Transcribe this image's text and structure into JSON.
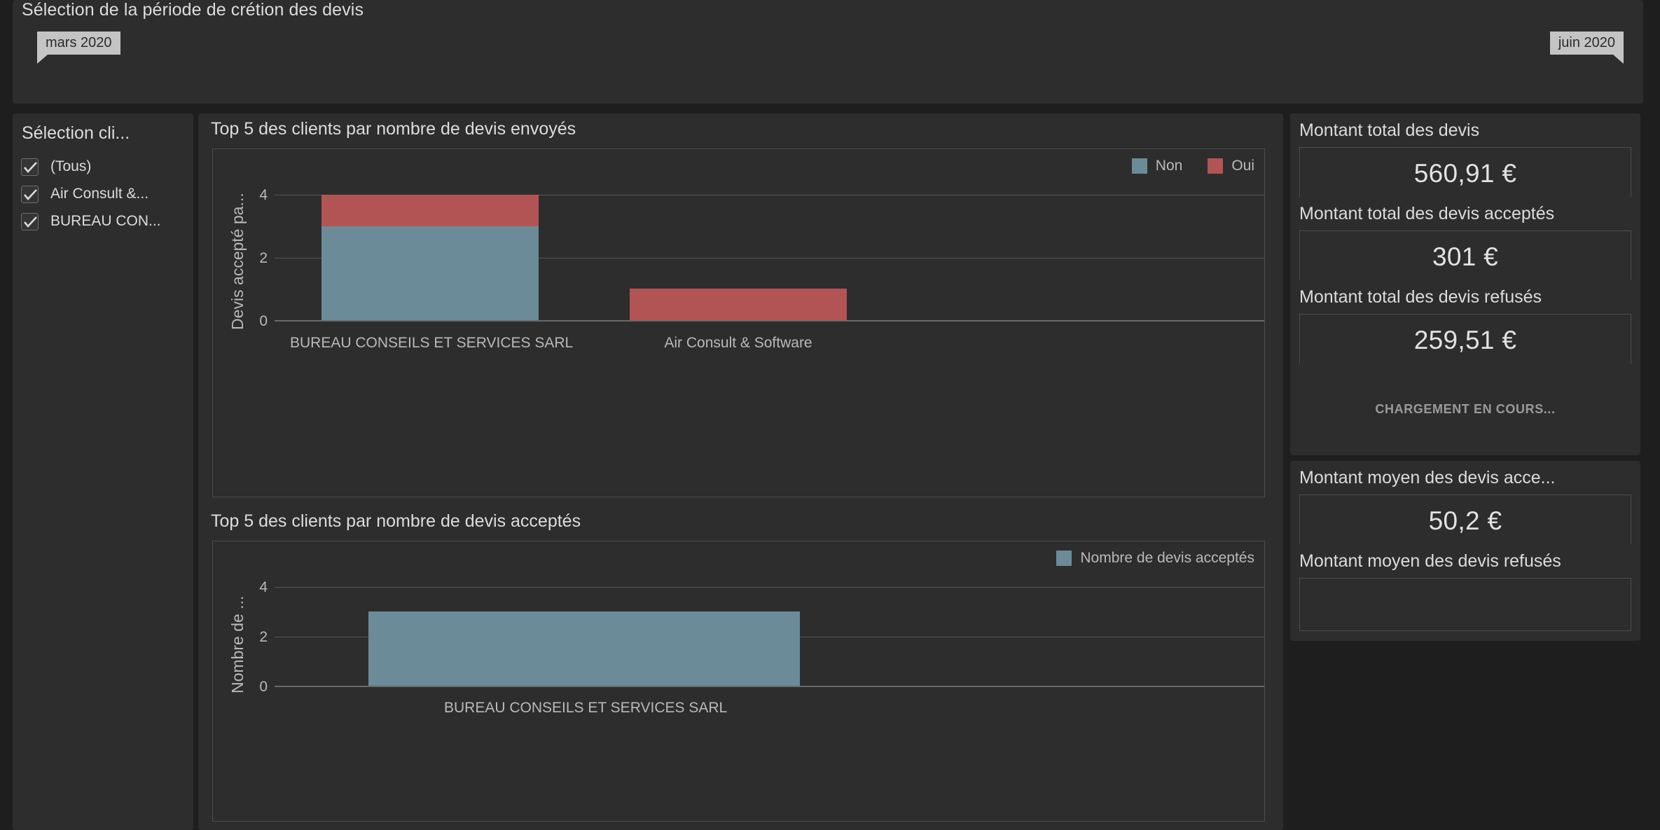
{
  "period": {
    "title": "Sélection de la période de crétion des devis",
    "start_label": "mars 2020",
    "end_label": "juin 2020"
  },
  "filter": {
    "title": "Sélection cli...",
    "items": [
      {
        "label": "(Tous)",
        "checked": true
      },
      {
        "label": "Air Consult &...",
        "checked": true
      },
      {
        "label": "BUREAU CON...",
        "checked": true
      }
    ]
  },
  "colors": {
    "series_non": "#6b8b99",
    "series_oui": "#b35454",
    "panel_bg": "#2d2d2d",
    "page_bg": "#1e1e1e",
    "text": "#dcdcdc"
  },
  "charts": [
    {
      "title": "Top 5 des clients par nombre de devis envoyés",
      "y_axis_title": "Devis accepté pa...",
      "legend": [
        {
          "label": "Non",
          "color": "#6b8b99"
        },
        {
          "label": "Oui",
          "color": "#b35454"
        }
      ],
      "y_ticks": [
        "0",
        "2",
        "4"
      ]
    },
    {
      "title": "Top 5 des clients par nombre de devis acceptés",
      "y_axis_title": "Nombre de ...",
      "legend": [
        {
          "label": "Nombre de devis acceptés",
          "color": "#6b8b99"
        }
      ],
      "y_ticks": [
        "0",
        "2",
        "4"
      ]
    }
  ],
  "chart_data": [
    {
      "type": "bar",
      "stacked": true,
      "title": "Top 5 des clients par nombre de devis envoyés",
      "xlabel": "",
      "ylabel": "Devis accepté pa...",
      "ylim": [
        0,
        4
      ],
      "yticks": [
        0,
        2,
        4
      ],
      "grid": true,
      "legend_position": "top-right",
      "categories": [
        "BUREAU CONSEILS ET SERVICES SARL",
        "Air Consult & Software"
      ],
      "series": [
        {
          "name": "Non",
          "color": "#6b8b99",
          "values": [
            3,
            0
          ]
        },
        {
          "name": "Oui",
          "color": "#b35454",
          "values": [
            1,
            1
          ]
        }
      ]
    },
    {
      "type": "bar",
      "stacked": false,
      "title": "Top 5 des clients par nombre de devis acceptés",
      "xlabel": "",
      "ylabel": "Nombre de ...",
      "ylim": [
        0,
        4
      ],
      "yticks": [
        0,
        2,
        4
      ],
      "grid": true,
      "legend_position": "top-right",
      "categories": [
        "BUREAU CONSEILS ET SERVICES SARL"
      ],
      "series": [
        {
          "name": "Nombre de devis acceptés",
          "color": "#6b8b99",
          "values": [
            3
          ]
        }
      ]
    }
  ],
  "kpis": [
    {
      "title": "Montant total des devis",
      "value": "560,91 €"
    },
    {
      "title": "Montant total des devis acceptés",
      "value": "301 €"
    },
    {
      "title": "Montant total des devis refusés",
      "value": "259,51 €"
    },
    {
      "title": "Montant moyen des devis acce...",
      "value": "50,2 €"
    },
    {
      "title": "Montant moyen des devis refusés",
      "value": ""
    }
  ],
  "loading_card": {
    "text": "CHARGEMENT EN COURS..."
  }
}
